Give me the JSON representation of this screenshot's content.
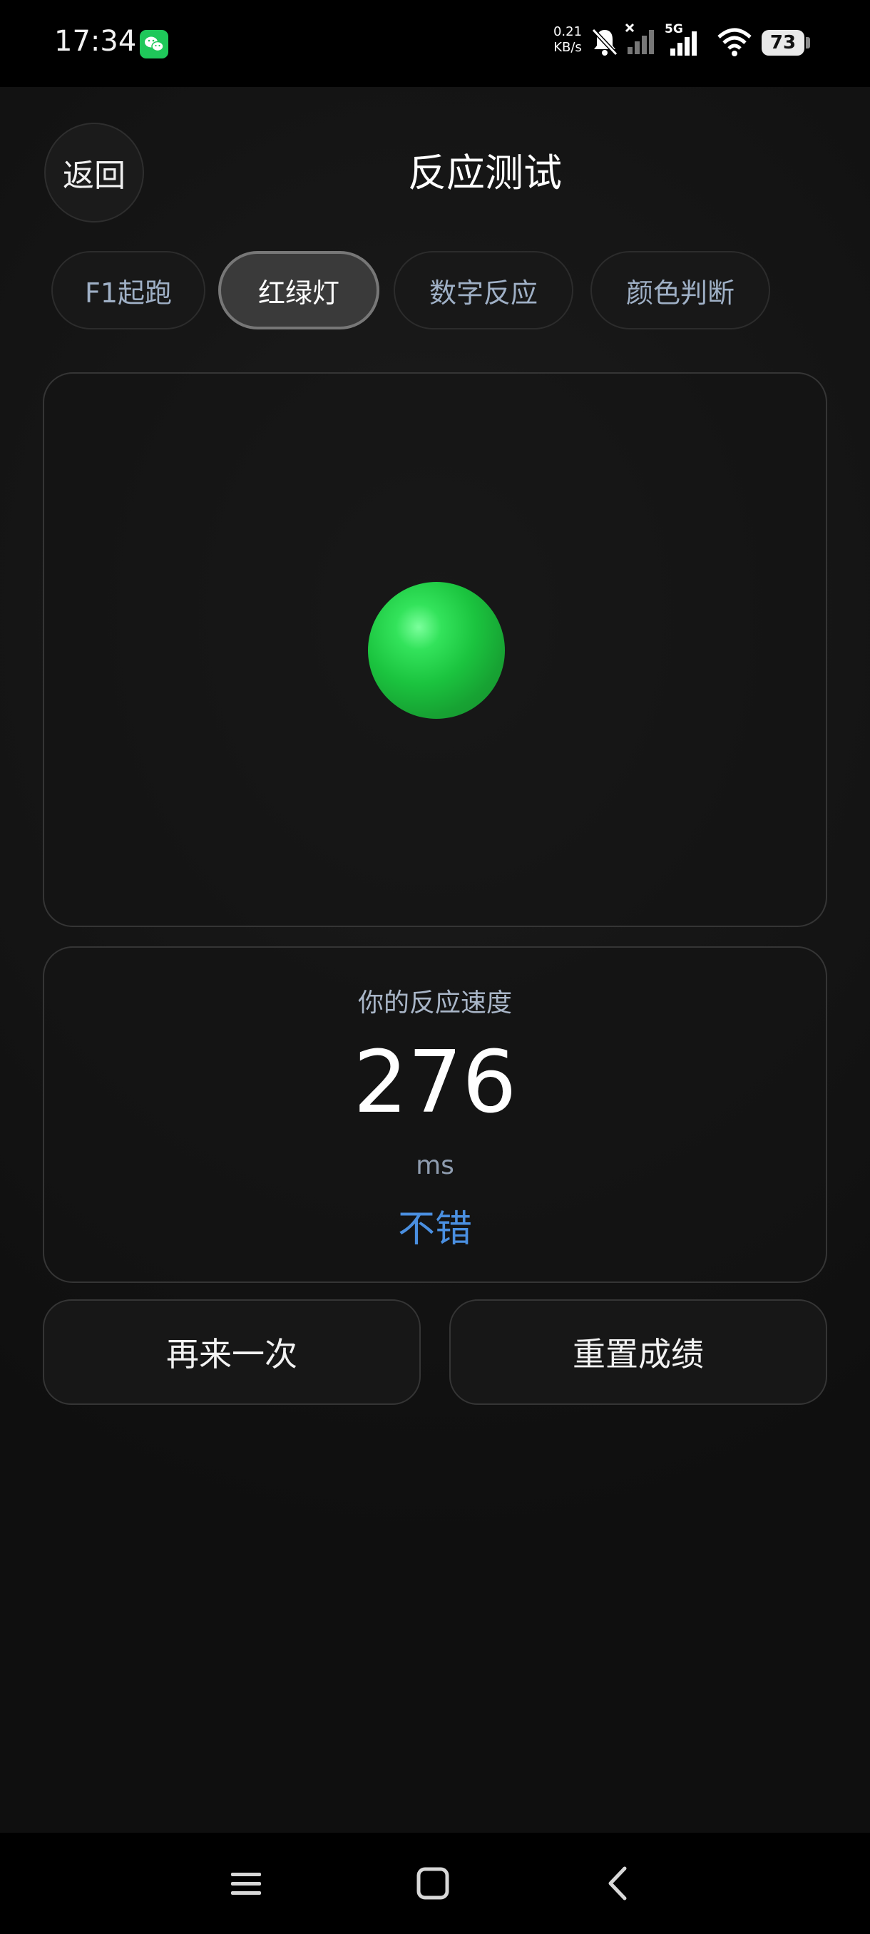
{
  "status_bar": {
    "time": "17:34",
    "app_icon": "wechat-icon",
    "net_speed_value": "0.21",
    "net_speed_unit": "KB/s",
    "network_type": "5G",
    "battery_level": "73",
    "icons": [
      "bell-muted-icon",
      "signal-no-service-icon",
      "signal-5g-icon",
      "wifi-icon",
      "battery-icon"
    ]
  },
  "header": {
    "back_label": "返回",
    "title": "反应测试"
  },
  "tabs": [
    {
      "label": "F1起跑",
      "active": false
    },
    {
      "label": "红绿灯",
      "active": true
    },
    {
      "label": "数字反应",
      "active": false
    },
    {
      "label": "颜色判断",
      "active": false
    }
  ],
  "game": {
    "light_state": "green",
    "light_color": "#22c442"
  },
  "result": {
    "label": "你的反应速度",
    "value": "276",
    "unit": "ms",
    "rating": "不错",
    "rating_color": "#4a8fe0"
  },
  "actions": {
    "retry_label": "再来一次",
    "reset_label": "重置成绩"
  },
  "nav_bar": {
    "icons": [
      "menu-icon",
      "home-icon",
      "back-icon"
    ]
  }
}
